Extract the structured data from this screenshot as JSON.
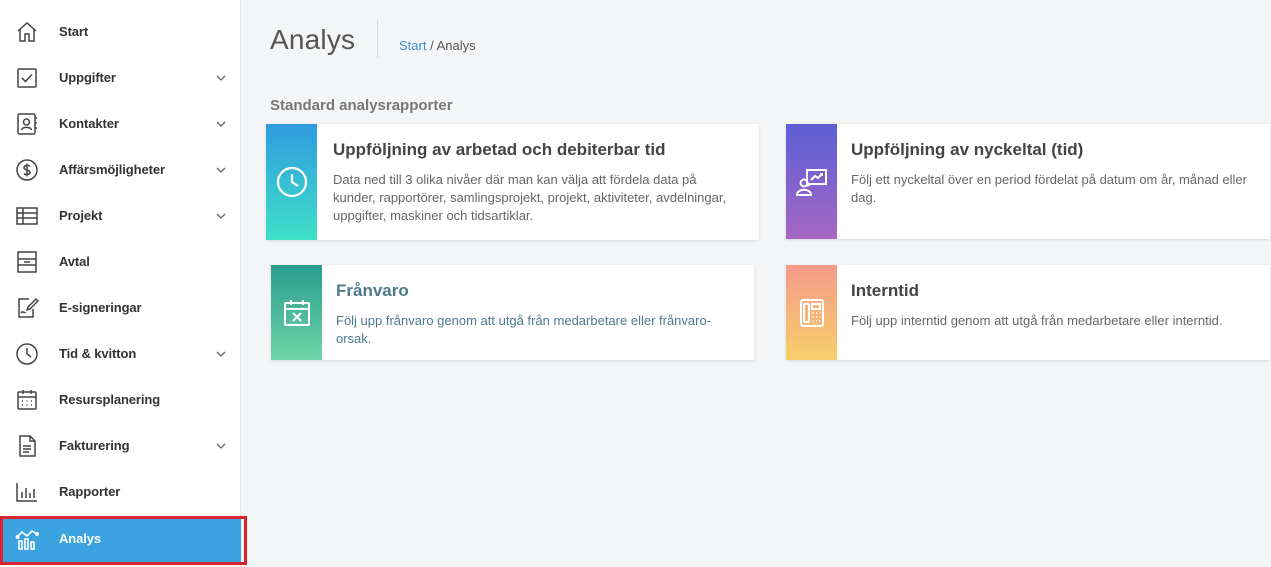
{
  "sidebar": {
    "items": [
      {
        "label": "Start",
        "icon": "home-icon",
        "has_chevron": false
      },
      {
        "label": "Uppgifter",
        "icon": "checkbox-icon",
        "has_chevron": true
      },
      {
        "label": "Kontakter",
        "icon": "contact-card-icon",
        "has_chevron": true
      },
      {
        "label": "Affärsmöjligheter",
        "icon": "dollar-icon",
        "has_chevron": true
      },
      {
        "label": "Projekt",
        "icon": "table-icon",
        "has_chevron": true
      },
      {
        "label": "Avtal",
        "icon": "contract-icon",
        "has_chevron": false
      },
      {
        "label": "E-signeringar",
        "icon": "signature-icon",
        "has_chevron": false
      },
      {
        "label": "Tid & kvitton",
        "icon": "clock-icon",
        "has_chevron": true
      },
      {
        "label": "Resursplanering",
        "icon": "calendar-icon",
        "has_chevron": false
      },
      {
        "label": "Fakturering",
        "icon": "document-icon",
        "has_chevron": true
      },
      {
        "label": "Rapporter",
        "icon": "bar-chart-icon",
        "has_chevron": false
      },
      {
        "label": "Analys",
        "icon": "analytics-icon",
        "has_chevron": false,
        "active": true
      }
    ]
  },
  "header": {
    "title": "Analys",
    "breadcrumb": {
      "home": "Start",
      "separator": "/",
      "current": "Analys"
    }
  },
  "main": {
    "section_heading": "Standard analysrapporter",
    "cards": [
      {
        "title": "Uppföljning av arbetad och debiterbar tid",
        "description": "Data ned till 3 olika nivåer där man kan välja att fördela data på kunder, rapportörer, samlingsprojekt, projekt, aktiviteter, avdelningar, uppgifter, maskiner och tidsartiklar.",
        "icon": "clock-icon",
        "gradient": [
          "#2f9be0",
          "#3fe0c8"
        ]
      },
      {
        "title": "Uppföljning av nyckeltal (tid)",
        "description": "Följ ett nyckeltal över en period fördelat på datum om år, månad eller dag.",
        "icon": "presentation-icon",
        "gradient": [
          "#5b5fd6",
          "#a667c4"
        ]
      },
      {
        "title": "Frånvaro",
        "description": "Följ upp frånvaro genom att utgå från medarbetare eller frånvaro-orsak.",
        "icon": "calendar-x-icon",
        "gradient": [
          "#2a9d8f",
          "#6fd4a8"
        ]
      },
      {
        "title": "Interntid",
        "description": "Följ upp interntid genom att utgå från medarbetare eller interntid.",
        "icon": "office-phone-icon",
        "gradient": [
          "#f59a8a",
          "#f7cf6a"
        ]
      }
    ]
  },
  "colors": {
    "accent": "#3aa3e0",
    "highlight_outline": "#d9232e",
    "link": "#3d8ed1"
  }
}
